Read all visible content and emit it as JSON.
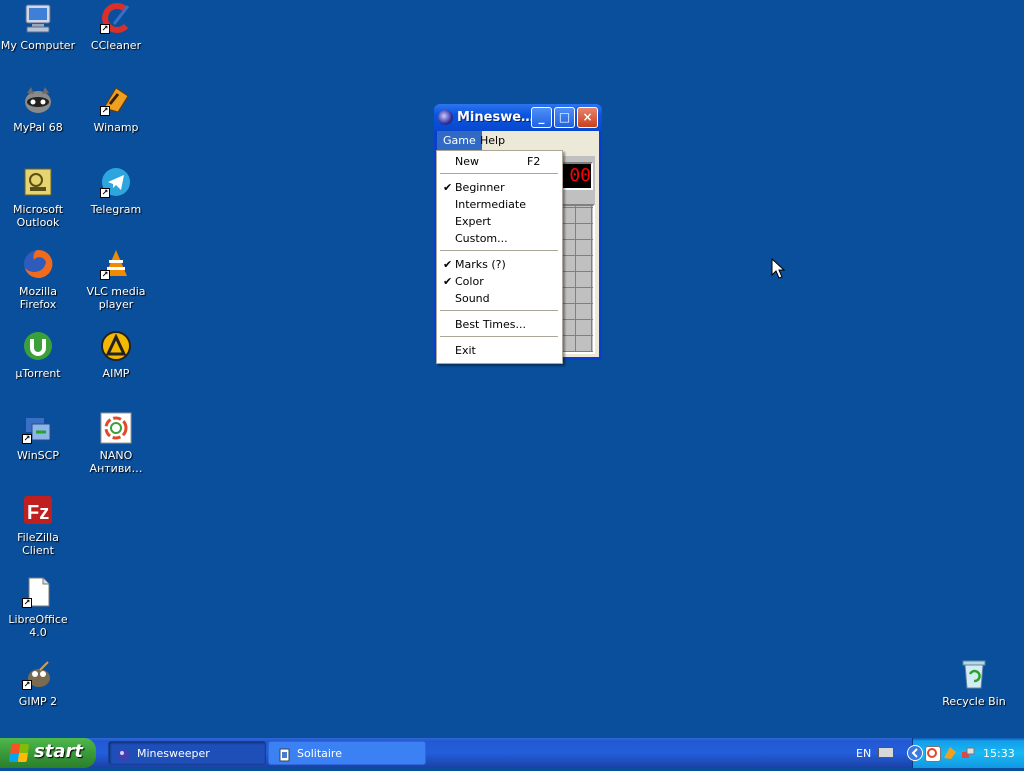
{
  "desktop": {
    "icons": [
      {
        "label": "My Computer",
        "icon": "computer-icon"
      },
      {
        "label": "CCleaner",
        "icon": "ccleaner-icon"
      },
      {
        "label": "MyPal 68",
        "icon": "mypal-icon"
      },
      {
        "label": "Winamp",
        "icon": "winamp-icon"
      },
      {
        "label": "Microsoft Outlook",
        "icon": "outlook-icon"
      },
      {
        "label": "Telegram",
        "icon": "telegram-icon"
      },
      {
        "label": "Mozilla Firefox",
        "icon": "firefox-icon"
      },
      {
        "label": "VLC media player",
        "icon": "vlc-icon"
      },
      {
        "label": "µTorrent",
        "icon": "utorrent-icon"
      },
      {
        "label": "AIMP",
        "icon": "aimp-icon"
      },
      {
        "label": "WinSCP",
        "icon": "winscp-icon"
      },
      {
        "label": "NANO Антиви…",
        "icon": "nano-antivirus-icon"
      },
      {
        "label": "FileZilla Client",
        "icon": "filezilla-icon"
      },
      {
        "label": "LibreOffice 4.0",
        "icon": "libreoffice-icon"
      },
      {
        "label": "GIMP 2",
        "icon": "gimp-icon"
      },
      {
        "label": "Recycle Bin",
        "icon": "recycle-bin-icon"
      }
    ]
  },
  "window": {
    "title": "Mineswe…",
    "buttons": {
      "minimize": "_",
      "maximize": "□",
      "close": "×"
    },
    "menu": [
      "Game",
      "Help"
    ],
    "counter": "00"
  },
  "game_menu": {
    "items": [
      {
        "label": "New",
        "accel": "F2",
        "checked": false
      },
      {
        "label": "Beginner",
        "accel": "",
        "checked": true
      },
      {
        "label": "Intermediate",
        "accel": "",
        "checked": false
      },
      {
        "label": "Expert",
        "accel": "",
        "checked": false
      },
      {
        "label": "Custom...",
        "accel": "",
        "checked": false
      },
      {
        "label": "Marks (?)",
        "accel": "",
        "checked": true
      },
      {
        "label": "Color",
        "accel": "",
        "checked": true
      },
      {
        "label": "Sound",
        "accel": "",
        "checked": false
      },
      {
        "label": "Best Times...",
        "accel": "",
        "checked": false
      },
      {
        "label": "Exit",
        "accel": "",
        "checked": false
      }
    ],
    "check_glyph": "✔"
  },
  "taskbar": {
    "start_label": "start",
    "tasks": [
      {
        "label": "Minesweeper",
        "active": true
      },
      {
        "label": "Solitaire",
        "active": false
      }
    ],
    "language": "EN",
    "clock": "15:33"
  },
  "colors": {
    "desktop_bg": "#0a4f9c",
    "menu_highlight": "#316ac5",
    "taskbar_blue": "#245edb",
    "start_green": "#3a9a3a"
  }
}
